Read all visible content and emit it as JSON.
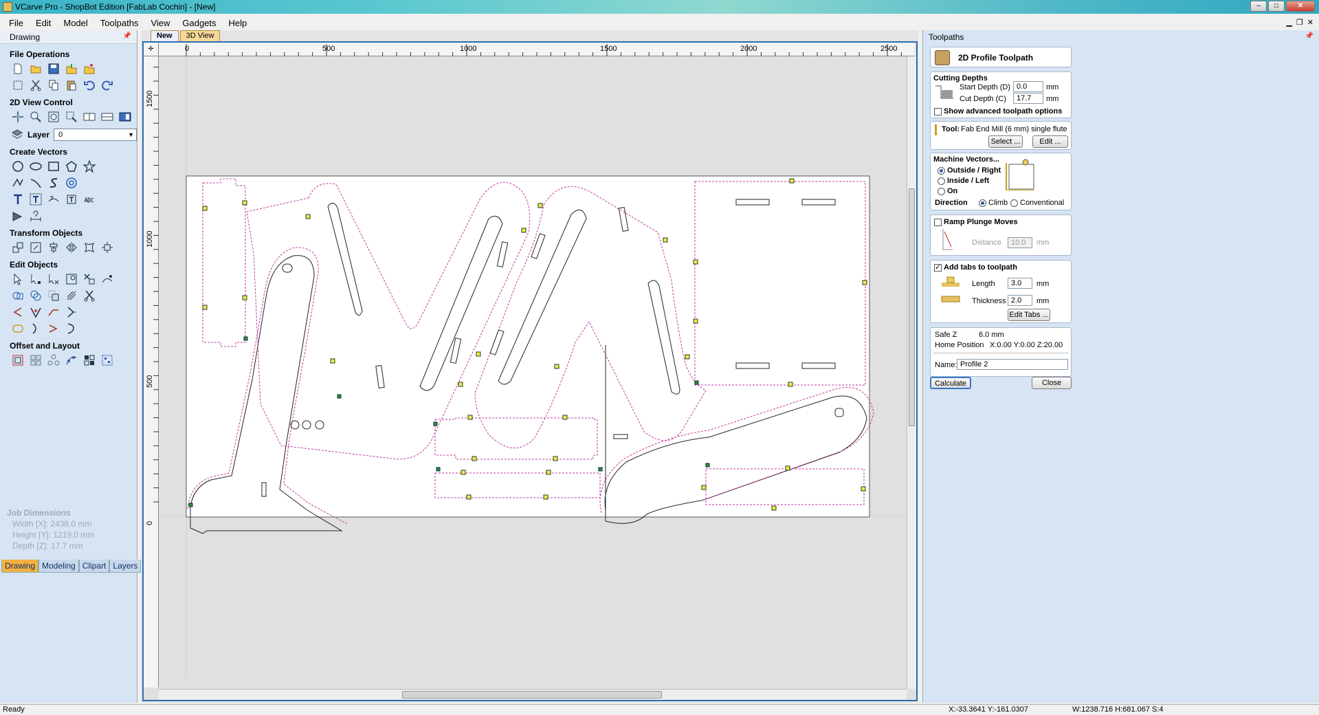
{
  "window": {
    "title": "VCarve Pro - ShopBot Edition [FabLab Cochin] - [New]",
    "controls": {
      "minimize": "–",
      "maximize": "□",
      "close": "✕"
    }
  },
  "menubar": [
    "File",
    "Edit",
    "Model",
    "Toolpaths",
    "View",
    "Gadgets",
    "Help"
  ],
  "left_panel": {
    "header": "Drawing",
    "sections": {
      "file_operations": "File Operations",
      "view_control": "2D View Control",
      "layer_label": "Layer",
      "layer_value": "0",
      "create_vectors": "Create Vectors",
      "transform_objects": "Transform Objects",
      "edit_objects": "Edit Objects",
      "offset_layout": "Offset and Layout"
    },
    "job_dimensions": {
      "title": "Job Dimensions",
      "width": "Width  [X]: 2438.0 mm",
      "height": "Height [Y]: 1219.0 mm",
      "depth": "Depth  [Z]: 17.7 mm"
    },
    "tabs": [
      "Drawing",
      "Modeling",
      "Clipart",
      "Layers"
    ],
    "active_tab": "Drawing"
  },
  "view": {
    "doc_tabs": [
      "New",
      "3D View"
    ],
    "active_doc_tab": "New",
    "ruler_x_labels": [
      "0",
      "500",
      "1000",
      "1500",
      "2000",
      "2500"
    ],
    "ruler_y_labels": [
      "1500",
      "1000",
      "500",
      "0"
    ]
  },
  "right_panel": {
    "header": "Toolpaths",
    "toolpath_title": "2D Profile Toolpath",
    "cutting_depths": {
      "title": "Cutting Depths",
      "start_label": "Start Depth (D)",
      "start_value": "0.0",
      "cut_label": "Cut Depth (C)",
      "cut_value": "17.7",
      "unit": "mm",
      "advanced_label": "Show advanced toolpath options",
      "advanced_checked": false
    },
    "tool": {
      "label": "Tool:",
      "value": "Fab End Mill (6 mm) single flute",
      "select_button": "Select ...",
      "edit_button": "Edit ..."
    },
    "machine_vectors": {
      "title": "Machine Vectors...",
      "options": [
        "Outside / Right",
        "Inside / Left",
        "On"
      ],
      "selected": "Outside / Right",
      "direction_label": "Direction",
      "direction_options": [
        "Climb",
        "Conventional"
      ],
      "direction_selected": "Climb"
    },
    "ramp": {
      "label": "Ramp Plunge Moves",
      "checked": false,
      "distance_label": "Distance",
      "distance_value": "10.0",
      "unit": "mm"
    },
    "tabs": {
      "label": "Add tabs to toolpath",
      "checked": true,
      "length_label": "Length",
      "length_value": "3.0",
      "thickness_label": "Thickness",
      "thickness_value": "2.0",
      "unit": "mm",
      "edit_button": "Edit Tabs ..."
    },
    "safe_z_label": "Safe Z",
    "safe_z_value": "6.0 mm",
    "home_label": "Home Position",
    "home_value": "X:0.00 Y:0.00 Z:20.00",
    "name_label": "Name:",
    "name_value": "Profile 2",
    "calculate_button": "Calculate",
    "close_button": "Close"
  },
  "statusbar": {
    "status": "Ready",
    "cursor": "X:-33.3641 Y:-161.0307",
    "selection": "W:1238.716   H:681.067  S:4"
  },
  "colors": {
    "panel_bg": "#d6e4f4",
    "toolpath": "#c03aa0",
    "vector": "#000000",
    "tab_marker": "#e8f040",
    "canvas_border": "#2c6cb0"
  }
}
